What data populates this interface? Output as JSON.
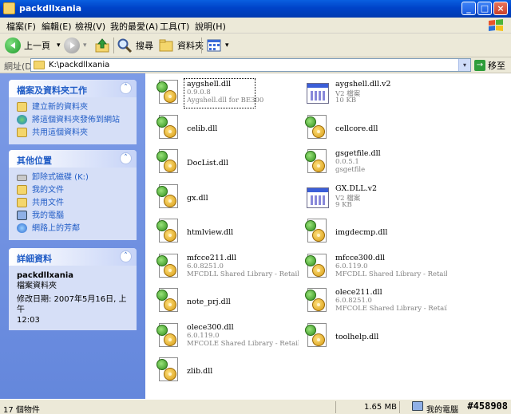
{
  "window": {
    "title": "packdllxania",
    "buttons": {
      "minimize": "_",
      "maximize": "□",
      "close": "×"
    }
  },
  "menubar": {
    "items": [
      "檔案(F)",
      "編輯(E)",
      "檢視(V)",
      "我的最愛(A)",
      "工具(T)",
      "說明(H)"
    ]
  },
  "toolbar": {
    "back_label": "上一頁",
    "dropdown_arrow": "▾",
    "search_label": "搜尋",
    "folders_label": "資料夾"
  },
  "address": {
    "label": "網址(D)",
    "path": "K:\\packdllxania",
    "go_label": "移至",
    "go_arrow": "→"
  },
  "leftpane": {
    "file_tasks": {
      "title": "檔案及資料夾工作",
      "collapse": "˄",
      "items": [
        "建立新的資料夾",
        "將這個資料夾發佈到網站",
        "共用這個資料夾"
      ]
    },
    "other_places": {
      "title": "其他位置",
      "collapse": "˄",
      "items": [
        "卸除式磁碟 (K:)",
        "我的文件",
        "共用文件",
        "我的電腦",
        "網路上的芳鄰"
      ]
    },
    "details": {
      "title": "詳細資料",
      "collapse": "˄",
      "name": "packdllxania",
      "type": "檔案資料夾",
      "modified": "修改日期: 2007年5月16日, 上午",
      "time": "12:03"
    }
  },
  "files": [
    {
      "name": "aygshell.dll",
      "line1": "0.9.0.8",
      "line2": "Aygshell.dll for BE300",
      "icon": "dll-icon"
    },
    {
      "name": "aygshell.dll.v2",
      "line1": "V2 檔案",
      "line2": "10 KB",
      "icon": "v2-file-icon"
    },
    {
      "name": "celib.dll",
      "icon": "dll-icon"
    },
    {
      "name": "cellcore.dll",
      "icon": "dll-icon"
    },
    {
      "name": "DocList.dll",
      "icon": "dll-icon"
    },
    {
      "name": "gsgetfile.dll",
      "line1": "0.0.5.1",
      "line2": "gsgetfile",
      "icon": "dll-icon"
    },
    {
      "name": "gx.dll",
      "icon": "dll-icon"
    },
    {
      "name": "GX.DLL.v2",
      "line1": "V2 檔案",
      "line2": "9 KB",
      "icon": "v2-file-icon"
    },
    {
      "name": "htmlview.dll",
      "icon": "dll-icon"
    },
    {
      "name": "imgdecmp.dll",
      "icon": "dll-icon"
    },
    {
      "name": "mfcce211.dll",
      "line1": "6.0.8251.0",
      "line2": "MFCDLL Shared Library - Retail V...",
      "icon": "dll-icon"
    },
    {
      "name": "mfcce300.dll",
      "line1": "6.0.119.0",
      "line2": "MFCDLL Shared Library - Retail V...",
      "icon": "dll-icon"
    },
    {
      "name": "note_prj.dll",
      "icon": "dll-icon"
    },
    {
      "name": "olece211.dll",
      "line1": "6.0.8251.0",
      "line2": "MFCOLE Shared Library - Retail V...",
      "icon": "dll-icon"
    },
    {
      "name": "olece300.dll",
      "line1": "6.0.119.0",
      "line2": "MFCOLE Shared Library - Retail V...",
      "icon": "dll-icon"
    },
    {
      "name": "toolhelp.dll",
      "icon": "dll-icon"
    },
    {
      "name": "zlib.dll",
      "icon": "dll-icon"
    }
  ],
  "statusbar": {
    "count": "17 個物件",
    "size": "1.65 MB",
    "location": "我的電腦"
  },
  "watermark": "#458908"
}
